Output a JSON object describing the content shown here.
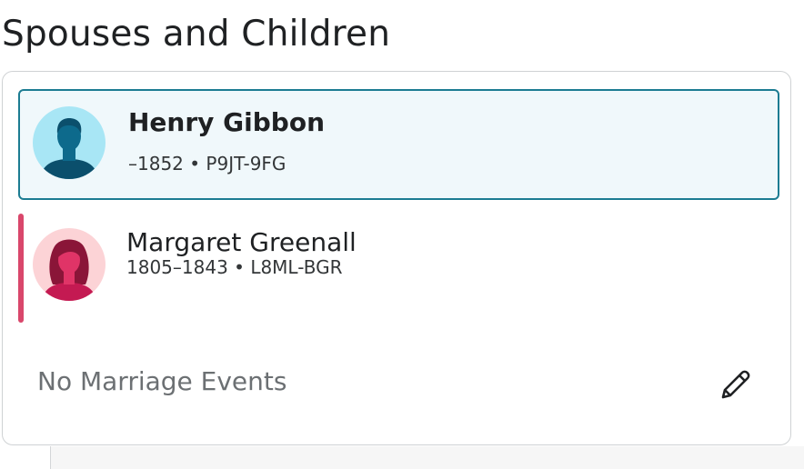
{
  "section": {
    "title": "Spouses and Children"
  },
  "couple": {
    "husband": {
      "name": "Henry Gibbon",
      "lifespan": "–1852",
      "separator": "•",
      "pid": "P9JT-9FG",
      "icon": "male-avatar-icon",
      "avatar_bg": "#a8e6f5",
      "avatar_fg": "#0b4f6c",
      "selected": true,
      "border_color": "#1c7c92",
      "background": "#f0f8fb"
    },
    "wife": {
      "name": "Margaret Greenall",
      "lifespan": "1805–1843",
      "separator": "•",
      "pid": "L8ML-BGR",
      "icon": "female-avatar-icon",
      "avatar_bg": "#fcd3d6",
      "avatar_fg": "#c41a52",
      "sex_color": "#d9476b"
    },
    "marriage": {
      "text": "No Marriage Events",
      "edit_icon": "pencil-icon"
    }
  }
}
